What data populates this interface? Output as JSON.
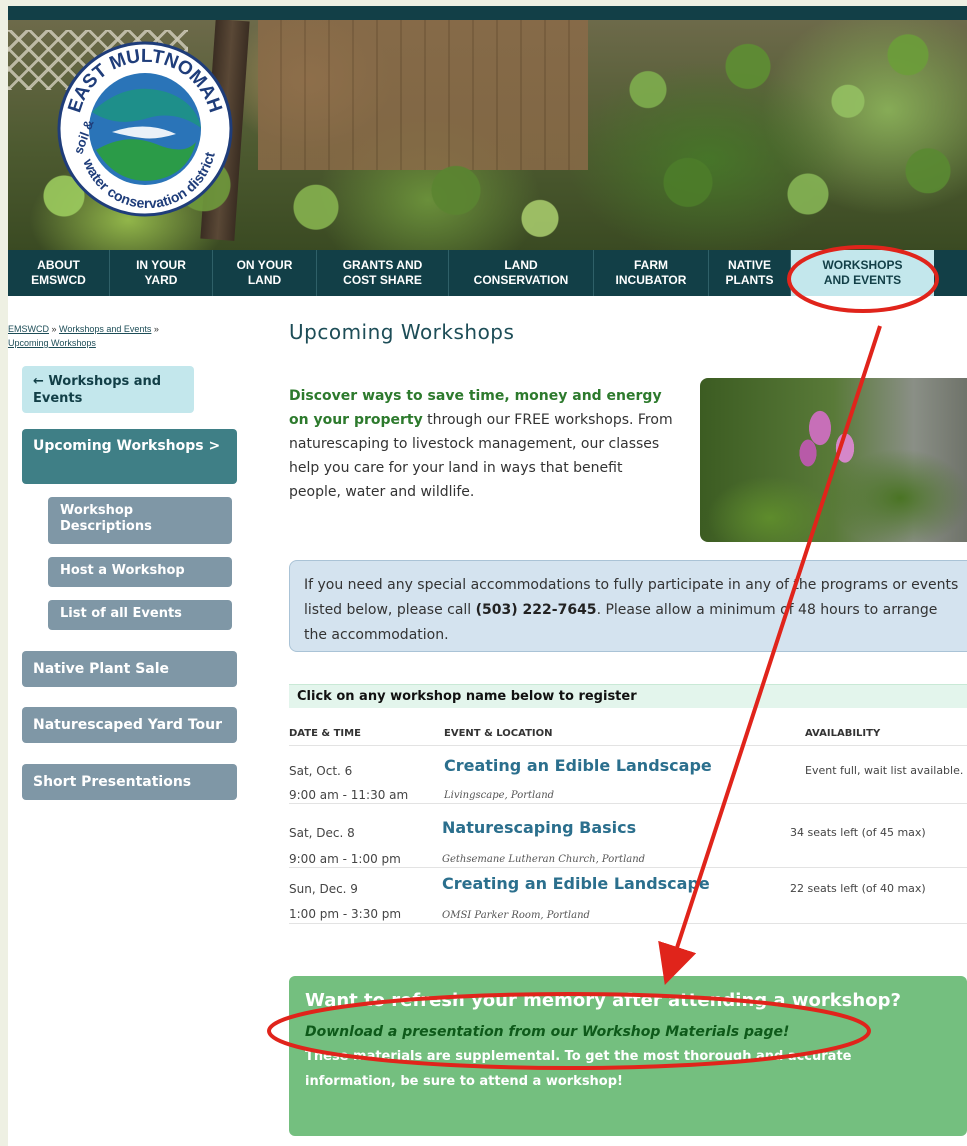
{
  "logo": {
    "alt_text": "East Multnomah Soil & Water Conservation District",
    "ring_top": "EAST MULTNOMAH",
    "ring_left": "soil &",
    "ring_bottom": "water conservation district",
    "colors": {
      "teal": "#1e8f8a",
      "blue": "#2a74b8",
      "green": "#2b9b48",
      "ring": "#1f3d7a"
    }
  },
  "nav": {
    "items": [
      {
        "label": "ABOUT\nEMSWCD"
      },
      {
        "label": "IN YOUR\nYARD"
      },
      {
        "label": "ON YOUR\nLAND"
      },
      {
        "label": "GRANTS AND\nCOST SHARE"
      },
      {
        "label": "LAND\nCONSERVATION"
      },
      {
        "label": "FARM\nINCUBATOR"
      },
      {
        "label": "NATIVE\nPLANTS"
      },
      {
        "label": "WORKSHOPS\nAND EVENTS"
      }
    ]
  },
  "breadcrumb": {
    "home": "EMSWCD",
    "sep": " » ",
    "parent": "Workshops and Events",
    "current": "Upcoming Workshops"
  },
  "sidebar": {
    "back_label": "← Workshops and Events",
    "current_label": "Upcoming Workshops >",
    "sub_items": [
      {
        "label": "Workshop Descriptions"
      },
      {
        "label": "Host a Workshop"
      },
      {
        "label": "List of all Events"
      }
    ],
    "main_items": [
      {
        "label": "Native Plant Sale"
      },
      {
        "label": "Naturescaped Yard Tour"
      },
      {
        "label": "Short Presentations"
      }
    ]
  },
  "main": {
    "title": "Upcoming Workshops",
    "intro_bold": "Discover ways to save time, money and energy on your property",
    "intro_rest": " through our FREE workshops. From naturescaping to livestock management, our classes help you care for your land in ways that benefit people, water and wildlife.",
    "accommodation_pre": "If you need any special accommodations to fully participate in any of the programs or events listed below, please call ",
    "accommodation_phone": "(503) 222-7645",
    "accommodation_post": ". Please allow a minimum of 48 hours to arrange the accommodation."
  },
  "workshops": {
    "instruction": "Click on any workshop name below to register",
    "columns": [
      "DATE & TIME",
      "EVENT & LOCATION",
      "AVAILABILITY"
    ],
    "rows": [
      {
        "date": "Sat, Oct. 6",
        "time": "9:00 am - 11:30 am",
        "event": "Creating an Edible Landscape",
        "location": "Livingscape, Portland",
        "availability": "Event full, wait list available."
      },
      {
        "date": "Sat, Dec. 8",
        "time": "9:00 am - 1:00 pm",
        "event": "Naturescaping Basics",
        "location": "Gethsemane Lutheran Church, Portland",
        "availability": "34 seats left (of 45 max)"
      },
      {
        "date": "Sun, Dec. 9",
        "time": "1:00 pm - 3:30 pm",
        "event": "Creating an Edible Landscape",
        "location": "OMSI Parker Room, Portland",
        "availability": "22 seats left (of 40 max)"
      }
    ]
  },
  "refresh": {
    "heading": "Want to refresh your memory after attending a workshop?",
    "link": "Download a presentation from our Workshop Materials page!",
    "note": "These materials are supplemental. To get the most thorough and accurate information, be sure to attend a workshop!"
  },
  "annotation": {
    "color": "#e0241b"
  }
}
